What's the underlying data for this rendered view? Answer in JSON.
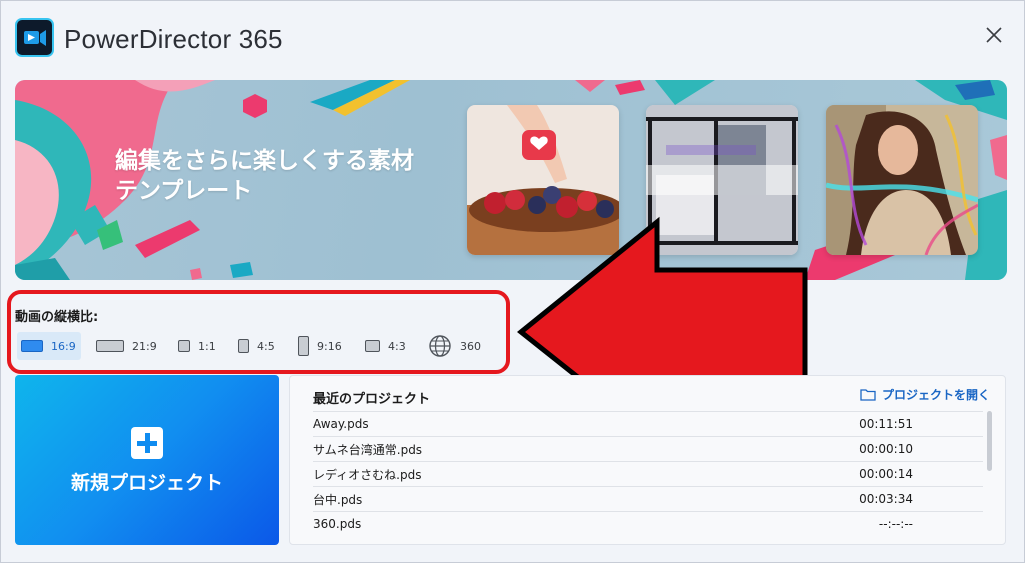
{
  "app": {
    "title": "PowerDirector 365",
    "logo_icon": "powerdirector-logo-icon",
    "close_icon": "close-icon"
  },
  "banner": {
    "text_line1": "編集をさらに楽しくする素材",
    "text_line2": "テンプレート"
  },
  "aspect": {
    "label": "動画の縦横比:",
    "options": [
      {
        "label": "16:9",
        "selected": true
      },
      {
        "label": "21:9",
        "selected": false
      },
      {
        "label": "1:1",
        "selected": false
      },
      {
        "label": "4:5",
        "selected": false
      },
      {
        "label": "9:16",
        "selected": false
      },
      {
        "label": "4:3",
        "selected": false
      },
      {
        "label": "360",
        "selected": false
      }
    ]
  },
  "new_project": {
    "label": "新規プロジェクト",
    "icon": "plus-icon"
  },
  "recent": {
    "title": "最近のプロジェクト",
    "open_label": "プロジェクトを開く",
    "open_icon": "folder-icon",
    "rows": [
      {
        "name": "Away.pds",
        "duration": "00:11:51"
      },
      {
        "name": "サムネ台湾通常.pds",
        "duration": "00:00:10"
      },
      {
        "name": "レディオさむね.pds",
        "duration": "00:00:14"
      },
      {
        "name": "台中.pds",
        "duration": "00:03:34"
      },
      {
        "name": "360.pds",
        "duration": "--:--:--"
      }
    ]
  },
  "colors": {
    "accent": "#2f8bef",
    "annotation_red": "#e5181e",
    "new_project_gradient_start": "#0fb5ec",
    "new_project_gradient_end": "#0b58e8"
  }
}
